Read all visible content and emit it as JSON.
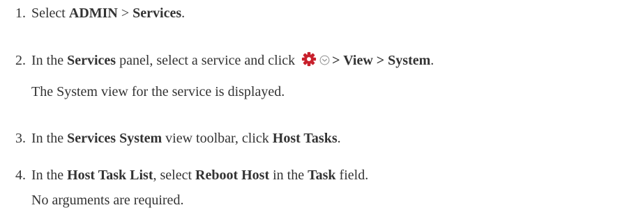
{
  "steps": [
    {
      "number": "1.",
      "parts": [
        "Select ",
        "ADMIN",
        " > ",
        "Services",
        "."
      ]
    },
    {
      "number": "2.",
      "parts": [
        "In the ",
        "Services",
        " panel, select a service and click ",
        "> View > System",
        "."
      ],
      "note": "The System view for the service is displayed."
    },
    {
      "number": "3.",
      "parts": [
        "In the ",
        "Services System",
        " view toolbar, click ",
        "Host Tasks",
        "."
      ]
    },
    {
      "number": "4.",
      "parts": [
        "In the ",
        "Host Task List",
        ", select ",
        "Reboot Host",
        " in the ",
        "Task",
        " field."
      ],
      "note": "No arguments are required."
    }
  ],
  "icons": {
    "gear": "gear-icon",
    "chevron": "chevron-down-circle-icon"
  },
  "colors": {
    "text": "#333333",
    "gear": "#c8202c",
    "chevron": "#9a9a9a"
  }
}
